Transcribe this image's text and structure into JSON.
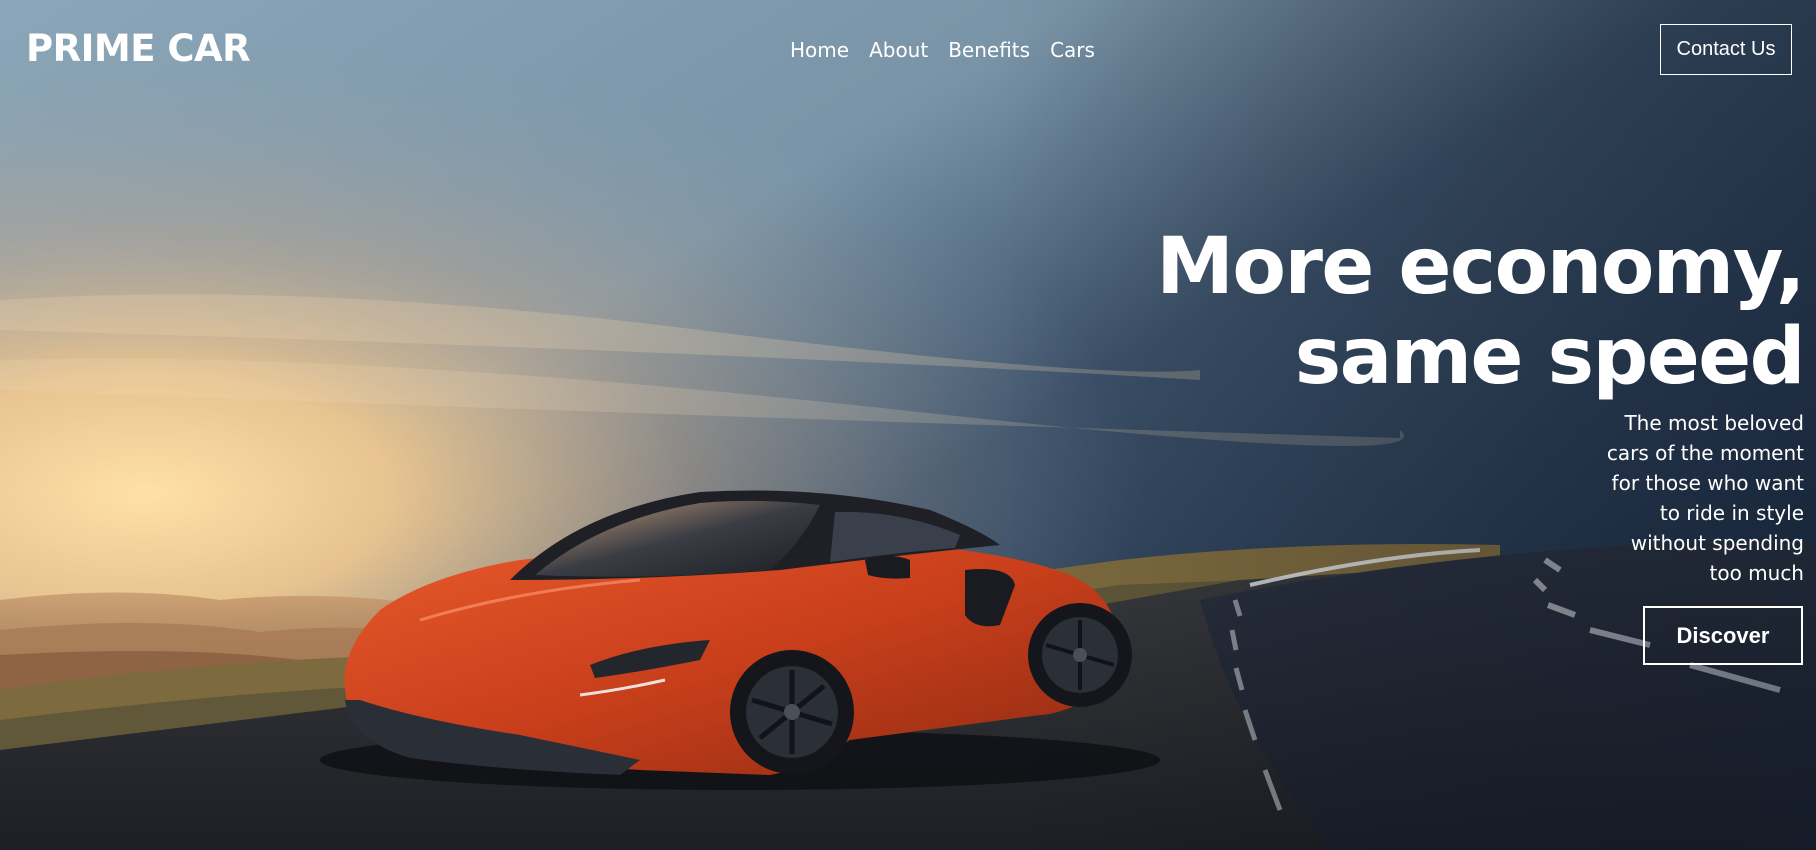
{
  "header": {
    "logo": "PRIME CAR",
    "nav": [
      {
        "label": "Home"
      },
      {
        "label": "About"
      },
      {
        "label": "Benefits"
      },
      {
        "label": "Cars"
      }
    ],
    "contact_label": "Contact Us"
  },
  "hero": {
    "headline_line1": "More economy,",
    "headline_line2": "same speed",
    "subtext": "The most beloved cars of the moment for those who want to ride in style without spending too much",
    "cta_label": "Discover"
  },
  "colors": {
    "text": "#ffffff",
    "car_body": "#d2461e",
    "sky_top": "#23344d",
    "sunset": "#f3c98e"
  }
}
